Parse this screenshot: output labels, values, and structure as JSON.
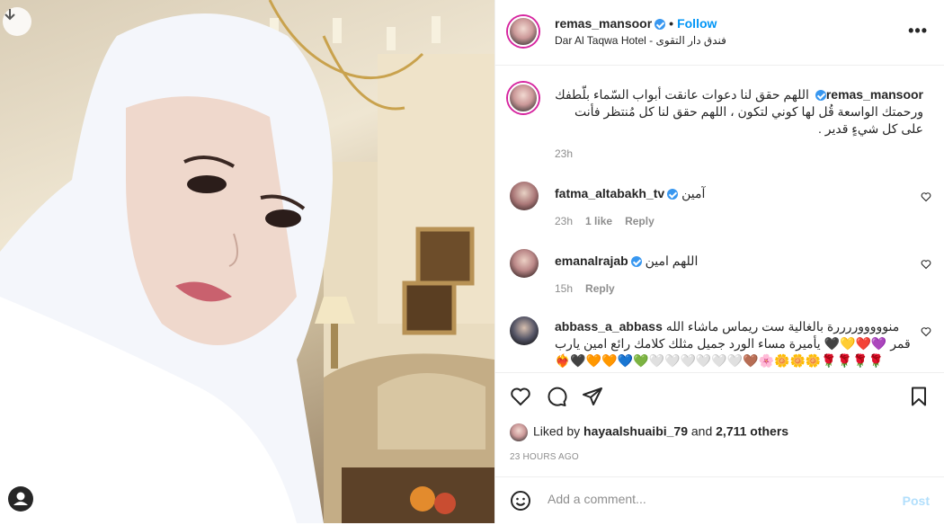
{
  "header": {
    "username": "remas_mansoor",
    "follow_label": "Follow",
    "dot": "•",
    "location": "Dar Al Taqwa Hotel - فندق دار التقوى",
    "more_label": "•••"
  },
  "caption": {
    "username": "remas_mansoor",
    "text": "اللهم حقق لنا دعوات عانقت أبواب السّماء بلّطفك ورحمتك الواسعة قُل لها كوني لتكون ، اللهم حقق لنا كل مُنتظر فأنت على كل شيءٍ قدير .",
    "time": "23h"
  },
  "comments": [
    {
      "username": "fatma_altabakh_tv",
      "text": "آمين",
      "time": "23h",
      "likes": "1 like",
      "reply": "Reply"
    },
    {
      "username": "emanalrajab",
      "text": "اللهم امين",
      "time": "15h",
      "reply": "Reply"
    },
    {
      "username": "abbass_a_abbass",
      "text": "منوووووررررة بالغالية ست ريماس ماشاء الله قمر 💜❤️💛🖤 يأميرة مساء الورد جميل مثلك كلامك رائع امين يارب ❤️‍🔥🖤🧡🧡💙💚🤍🤍🤍🤍🤍🤍🤎🌸🌼🌼🌼🌹🌹🌹🌹"
    }
  ],
  "liked_by": {
    "prefix": "Liked by ",
    "user": "hayaalshuaibi_79",
    "middle": " and ",
    "others": "2,711 others"
  },
  "timestamp": "23 HOURS AGO",
  "add_comment": {
    "placeholder": "Add a comment...",
    "post_label": "Post"
  },
  "colors": {
    "accent": "#0095f6",
    "verified": "#3897f0",
    "muted": "#8e8e8e"
  }
}
